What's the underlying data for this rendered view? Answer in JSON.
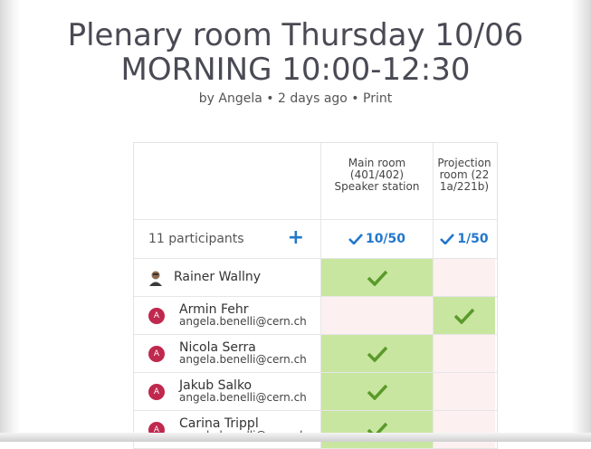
{
  "poll": {
    "title_line1": "Plenary room Thursday 10/06",
    "title_line2": "MORNING 10:00-12:30",
    "author": "by Angela",
    "sep1": " • ",
    "age": "2 days ago",
    "sep2": " • ",
    "print_label": "Print"
  },
  "options": [
    {
      "label": "Main room (401/402) Speaker station",
      "count": "10/50"
    },
    {
      "label": "Projection room (221a/221b)",
      "count": "1/50"
    }
  ],
  "participants_label": "11 participants",
  "add_icon": "plus-icon",
  "colors": {
    "accent": "#2277cc",
    "yes": "#c8e6a0",
    "no": "#fdf0f0",
    "avatar": "#c0284e",
    "check": "#5a9a2a"
  },
  "participants": [
    {
      "name": "Rainer Wallny",
      "email": "",
      "avatar": "photo",
      "votes": [
        "yes",
        "no"
      ]
    },
    {
      "name": "Armin Fehr",
      "email": "angela.benelli@cern.ch",
      "avatar": "A",
      "votes": [
        "no",
        "yes"
      ]
    },
    {
      "name": "Nicola Serra",
      "email": "angela.benelli@cern.ch",
      "avatar": "A",
      "votes": [
        "yes",
        "no"
      ]
    },
    {
      "name": "Jakub Salko",
      "email": "angela.benelli@cern.ch",
      "avatar": "A",
      "votes": [
        "yes",
        "no"
      ]
    },
    {
      "name": "Carina Trippl",
      "email": "angela.benelli@cern.ch",
      "avatar": "A",
      "votes": [
        "yes",
        "no"
      ]
    }
  ]
}
